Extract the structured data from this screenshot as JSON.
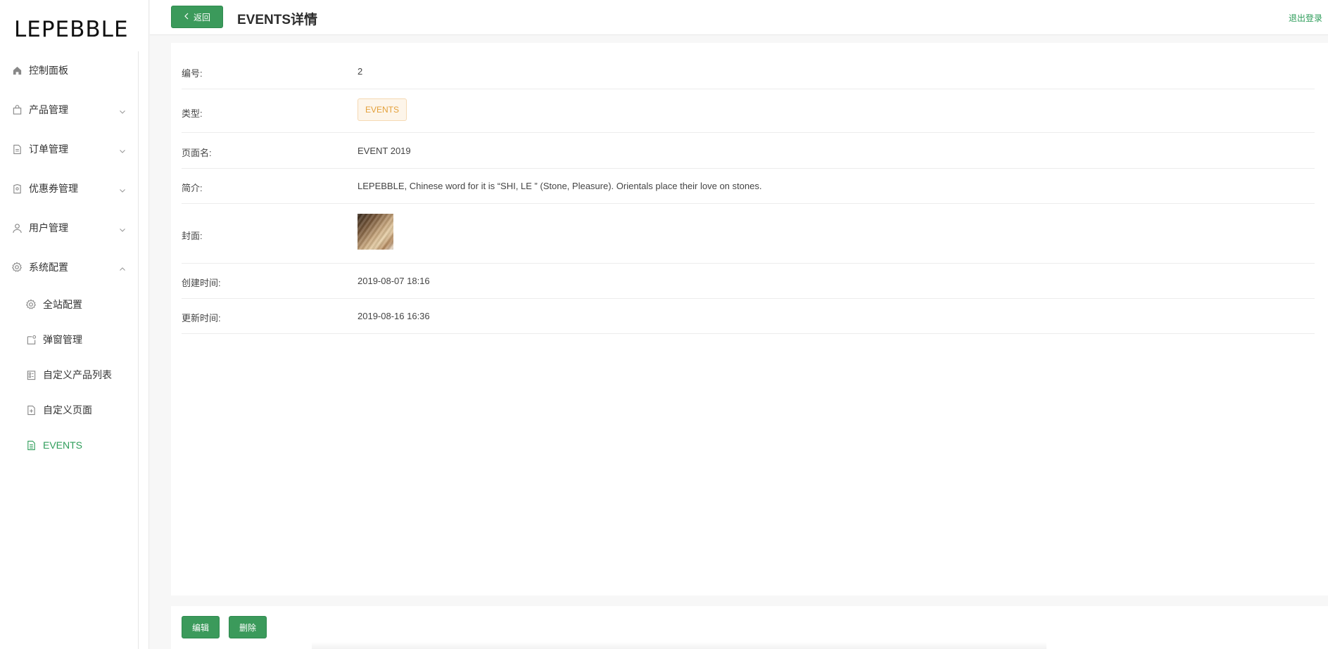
{
  "brand": {
    "logo_text": "LEPEBBLE",
    "accent": "#2e9d5a"
  },
  "header": {
    "back_label": "返回",
    "title": "EVENTS详情",
    "logout_label": "退出登录"
  },
  "sidebar": {
    "items": [
      {
        "label": "控制面板",
        "icon": "home-icon"
      },
      {
        "label": "产品管理",
        "icon": "bag-icon",
        "expandable": true
      },
      {
        "label": "订单管理",
        "icon": "document-icon",
        "expandable": true
      },
      {
        "label": "优惠券管理",
        "icon": "coupon-icon",
        "expandable": true
      },
      {
        "label": "用户管理",
        "icon": "user-icon",
        "expandable": true
      },
      {
        "label": "系统配置",
        "icon": "gear-icon",
        "expandable": true,
        "expanded": true
      }
    ],
    "sub_items": [
      {
        "label": "全站配置",
        "icon": "gear-icon"
      },
      {
        "label": "弹窗管理",
        "icon": "popup-icon"
      },
      {
        "label": "自定义产品列表",
        "icon": "list-icon"
      },
      {
        "label": "自定义页面",
        "icon": "page-add-icon"
      },
      {
        "label": "EVENTS",
        "icon": "events-doc-icon",
        "active": true
      }
    ]
  },
  "detail": {
    "fields": [
      {
        "key": "编号:",
        "value": "2"
      },
      {
        "key": "类型:",
        "value": "EVENTS"
      },
      {
        "key": "页面名:",
        "value": "EVENT 2019"
      },
      {
        "key": "简介:",
        "value": "LEPEBBLE, Chinese word for it is “SHI, LE ” (Stone, Pleasure). Orientals place their love on stones."
      },
      {
        "key": "封面:",
        "value": ""
      },
      {
        "key": "创建时间:",
        "value": "2019-08-07 18:16"
      },
      {
        "key": "更新时间:",
        "value": "2019-08-16 16:36"
      }
    ],
    "type_tag_colors": {
      "text": "#e3a03a",
      "bg": "#fdf5ea",
      "border": "#f5d9b3"
    }
  },
  "footer": {
    "edit_label": "编辑",
    "delete_label": "删除"
  }
}
